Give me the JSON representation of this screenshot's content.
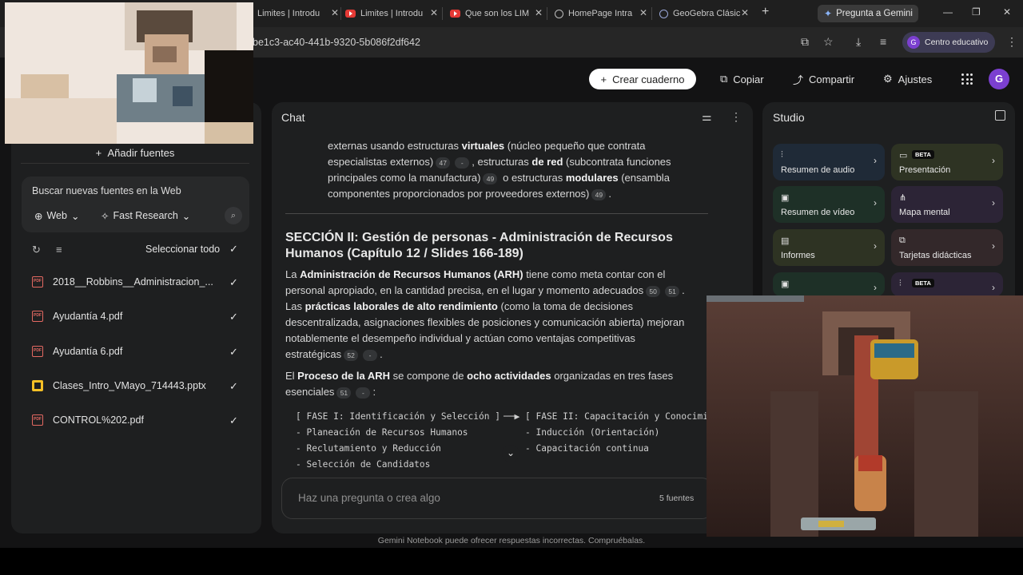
{
  "browser": {
    "tabs": [
      {
        "label": "Limites | Introdu",
        "icon": "youtube-icon"
      },
      {
        "label": "Limites | Introdu",
        "icon": "youtube-icon"
      },
      {
        "label": "Que son los LIM",
        "icon": "youtube-icon"
      },
      {
        "label": "HomePage Intra",
        "icon": "globe-icon"
      },
      {
        "label": "GeoGebra Clásic",
        "icon": "geogebra-icon"
      }
    ],
    "gemini_button": "Pregunta a Gemini",
    "url": "be1c3-ac40-441b-9320-5b086f2df642",
    "profile_label": "Centro educativo",
    "profile_initial": "G"
  },
  "header": {
    "create_notebook": "Crear cuaderno",
    "copy": "Copiar",
    "share": "Compartir",
    "settings": "Ajustes",
    "avatar_initial": "G"
  },
  "sources": {
    "add_sources": "Añadir fuentes",
    "search_web": "Buscar nuevas fuentes en la Web",
    "web_pill": "Web",
    "research_pill": "Fast Research",
    "select_all": "Seleccionar todo",
    "items": [
      {
        "name": "2018__Robbins__Administracion_...",
        "type": "pdf"
      },
      {
        "name": "Ayudantía 4.pdf",
        "type": "pdf"
      },
      {
        "name": "Ayudantía 6.pdf",
        "type": "pdf"
      },
      {
        "name": "Clases_Intro_VMayo_714443.pptx",
        "type": "pptx"
      },
      {
        "name": "CONTROL%202.pdf",
        "type": "pdf"
      }
    ]
  },
  "chat": {
    "title": "Chat",
    "p1": {
      "l1a": "externas usando estructuras ",
      "l1b": "virtuales",
      "l1c": " (núcleo pequeño que contrata",
      "l2a": "especialistas externos)",
      "l2c1": "47",
      "l2c2": "-",
      "l2b": ", estructuras ",
      "l2d": "de red",
      "l2e": " (subcontrata funciones",
      "l3a": "principales como la manufactura)",
      "l3c": "49",
      "l3b": " o estructuras ",
      "l3d": "modulares",
      "l3e": " (ensambla",
      "l4a": "componentes proporcionados por proveedores externos)",
      "l4c": "49",
      "l4b": "."
    },
    "section_title_1": "SECCIÓN II: Gestión de personas - Administración de Recursos",
    "section_title_2": "Humanos (Capítulo 12 / Slides 166-189)",
    "p2": {
      "l1a": "La ",
      "l1b": "Administración de Recursos Humanos (ARH)",
      "l1c": " tiene como meta contar con el",
      "l2a": "personal apropiado, en la cantidad precisa, en el lugar y momento adecuados",
      "l2c1": "50",
      "l2c2": "51",
      "l2b": ".",
      "l3a": "Las ",
      "l3b": "prácticas laborales de alto rendimiento",
      "l3c": " (como la toma de decisiones",
      "l4": "descentralizada, asignaciones flexibles de posiciones y comunicación abierta) mejoran",
      "l5": "notablemente el desempeño individual y actúan como ventajas competitivas",
      "l6a": "estratégicas",
      "l6c1": "52",
      "l6c2": "-",
      "l6b": "."
    },
    "p3": {
      "l1a": "El ",
      "l1b": "Proceso de la ARH",
      "l1c": " se compone de ",
      "l1d": "ocho actividades",
      "l1e": " organizadas en tres fases",
      "l2a": "esenciales",
      "l2c1": "51",
      "l2c2": "-",
      "l2b": ":"
    },
    "code": {
      "r1a": "[ FASE I: Identificación y Selección ]",
      "r1arrow": "──▶",
      "r1b": "[ FASE II: Capacitación y Conocimi",
      "r2a": "- Planeación de Recursos Humanos",
      "r2b": "- Inducción (Orientación)",
      "r3a": "- Reclutamiento y Reducción",
      "r3b": "- Capacitación continua",
      "r4a": "- Selección de Candidatos"
    },
    "input_placeholder": "Haz una pregunta o crea algo",
    "source_count": "5 fuentes"
  },
  "studio": {
    "title": "Studio",
    "cards": [
      {
        "label": "Resumen de audio",
        "icon": "audio-icon",
        "color": "#1f2a37",
        "beta": false
      },
      {
        "label": "Presentación",
        "icon": "slides-icon",
        "color": "#2e3323",
        "beta": true
      },
      {
        "label": "Resumen de vídeo",
        "icon": "video-icon",
        "color": "#1e3027",
        "beta": false
      },
      {
        "label": "Mapa mental",
        "icon": "mindmap-icon",
        "color": "#2c2436",
        "beta": false
      },
      {
        "label": "Informes",
        "icon": "report-icon",
        "color": "#2e3323",
        "beta": false
      },
      {
        "label": "Tarjetas didácticas",
        "icon": "flashcard-icon",
        "color": "#33282a",
        "beta": false
      }
    ],
    "beta_label": "BETA"
  },
  "footer": "Gemini Notebook puede ofrecer respuestas incorrectas. Compruébalas."
}
